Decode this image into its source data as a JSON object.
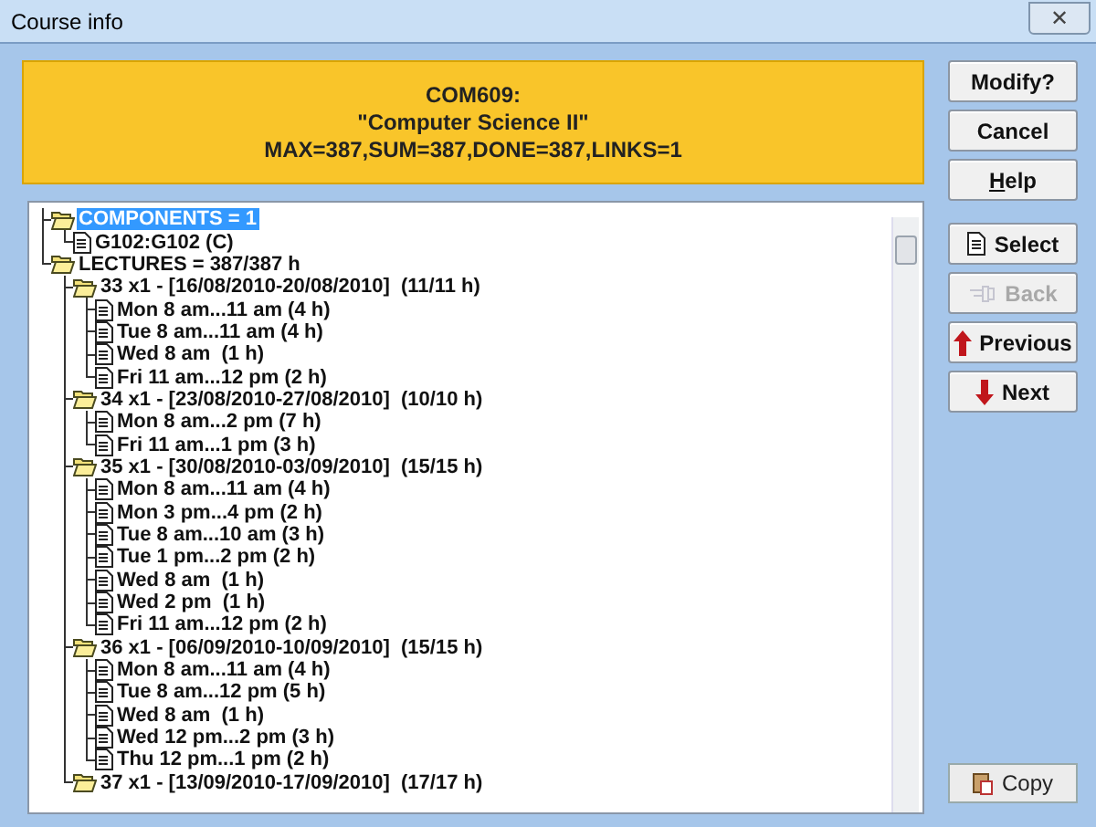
{
  "window": {
    "title": "Course info",
    "close": "✕"
  },
  "header": {
    "lines": [
      "COM609:",
      "\"Computer Science II\"",
      "MAX=387,SUM=387,DONE=387,LINKS=1"
    ]
  },
  "top_buttons": [
    {
      "label": "Modify?",
      "underline_first": false
    },
    {
      "label": "Cancel",
      "underline_first": false
    },
    {
      "label": "Help",
      "underline_first": true
    }
  ],
  "nav_buttons": [
    {
      "label": "Select",
      "kind": "select",
      "disabled": false
    },
    {
      "label": "Back",
      "kind": "back",
      "disabled": true
    },
    {
      "label": "Previous",
      "kind": "previous",
      "disabled": false
    },
    {
      "label": "Next",
      "kind": "next",
      "disabled": false
    }
  ],
  "tree": [
    {
      "label": "COMPONENTS = 1",
      "kind": "folder",
      "selected": true,
      "children": [
        {
          "label": "G102:G102 (C)",
          "kind": "item",
          "selected": false
        }
      ]
    },
    {
      "label": "LECTURES = 387/387 h",
      "kind": "folder",
      "selected": false,
      "children": [
        {
          "label": "33 x1 - [16/08/2010-20/08/2010]  (11/11 h)",
          "kind": "folder",
          "selected": false,
          "children": [
            {
              "label": "Mon 8 am...11 am (4 h)",
              "kind": "item",
              "selected": false
            },
            {
              "label": "Tue 8 am...11 am (4 h)",
              "kind": "item",
              "selected": false
            },
            {
              "label": "Wed 8 am  (1 h)",
              "kind": "item",
              "selected": false
            },
            {
              "label": "Fri 11 am...12 pm (2 h)",
              "kind": "item",
              "selected": false
            }
          ]
        },
        {
          "label": "34 x1 - [23/08/2010-27/08/2010]  (10/10 h)",
          "kind": "folder",
          "selected": false,
          "children": [
            {
              "label": "Mon 8 am...2 pm (7 h)",
              "kind": "item",
              "selected": false
            },
            {
              "label": "Fri 11 am...1 pm (3 h)",
              "kind": "item",
              "selected": false
            }
          ]
        },
        {
          "label": "35 x1 - [30/08/2010-03/09/2010]  (15/15 h)",
          "kind": "folder",
          "selected": false,
          "children": [
            {
              "label": "Mon 8 am...11 am (4 h)",
              "kind": "item",
              "selected": false
            },
            {
              "label": "Mon 3 pm...4 pm (2 h)",
              "kind": "item",
              "selected": false
            },
            {
              "label": "Tue 8 am...10 am (3 h)",
              "kind": "item",
              "selected": false
            },
            {
              "label": "Tue 1 pm...2 pm (2 h)",
              "kind": "item",
              "selected": false
            },
            {
              "label": "Wed 8 am  (1 h)",
              "kind": "item",
              "selected": false
            },
            {
              "label": "Wed 2 pm  (1 h)",
              "kind": "item",
              "selected": false
            },
            {
              "label": "Fri 11 am...12 pm (2 h)",
              "kind": "item",
              "selected": false
            }
          ]
        },
        {
          "label": "36 x1 - [06/09/2010-10/09/2010]  (15/15 h)",
          "kind": "folder",
          "selected": false,
          "children": [
            {
              "label": "Mon 8 am...11 am (4 h)",
              "kind": "item",
              "selected": false
            },
            {
              "label": "Tue 8 am...12 pm (5 h)",
              "kind": "item",
              "selected": false
            },
            {
              "label": "Wed 8 am  (1 h)",
              "kind": "item",
              "selected": false
            },
            {
              "label": "Wed 12 pm...2 pm (3 h)",
              "kind": "item",
              "selected": false
            },
            {
              "label": "Thu 12 pm...1 pm (2 h)",
              "kind": "item",
              "selected": false
            }
          ]
        },
        {
          "label": "37 x1 - [13/09/2010-17/09/2010]  (17/17 h)",
          "kind": "folder",
          "selected": false
        }
      ]
    }
  ],
  "copy_button": {
    "label": "Copy"
  }
}
